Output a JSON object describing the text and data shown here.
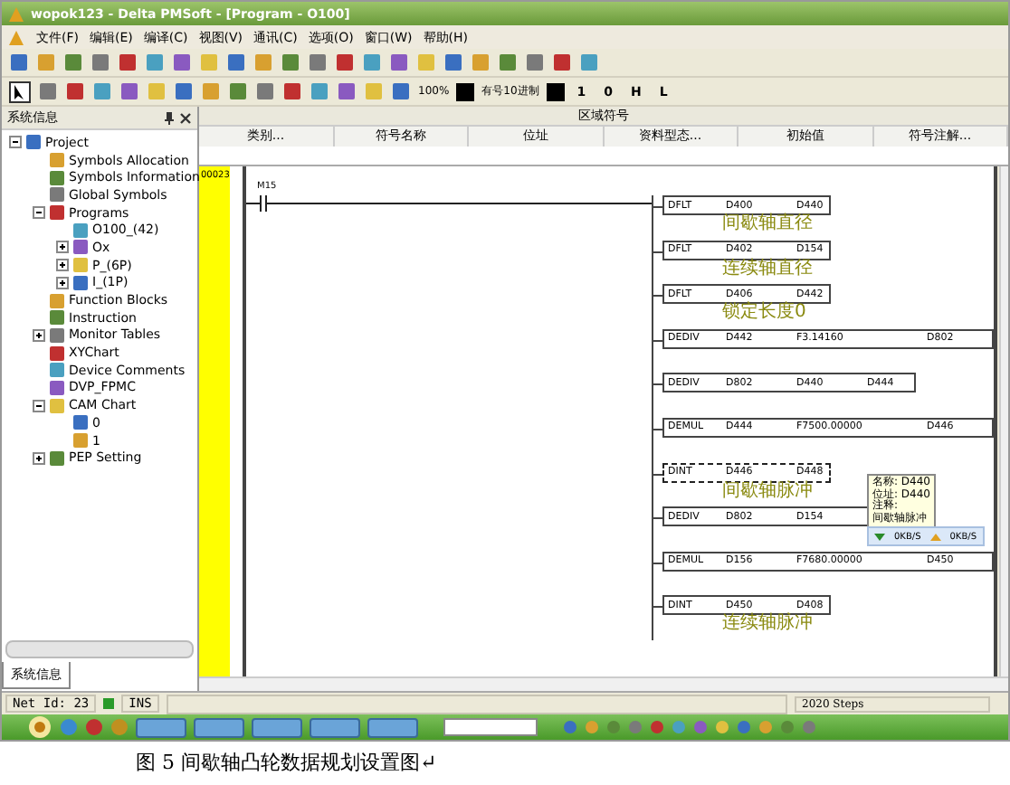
{
  "window": {
    "title": "wopok123 - Delta PMSoft - [Program - O100]"
  },
  "menu": [
    "文件(F)",
    "编辑(E)",
    "编译(C)",
    "视图(V)",
    "通讯(C)",
    "选项(O)",
    "窗口(W)",
    "帮助(H)"
  ],
  "toolbar": {
    "zoom": "100%",
    "number_format": "有号10进制",
    "labels": [
      "1",
      "0",
      "H",
      "L"
    ]
  },
  "system_panel": {
    "title": "系统信息",
    "tab": "系统信息",
    "tree": [
      {
        "label": "Project",
        "expanded": true,
        "children": [
          {
            "label": "Symbols Allocation"
          },
          {
            "label": "Symbols Information"
          },
          {
            "label": "Global Symbols"
          },
          {
            "label": "Programs",
            "expanded": true,
            "children": [
              {
                "label": "O100_(42)"
              },
              {
                "label": "Ox",
                "expanded": false
              },
              {
                "label": "P_(6P)",
                "expanded": false
              },
              {
                "label": "I_(1P)",
                "expanded": false
              }
            ]
          },
          {
            "label": "Function Blocks"
          },
          {
            "label": "Instruction"
          },
          {
            "label": "Monitor Tables",
            "expanded": false
          },
          {
            "label": "XYChart"
          },
          {
            "label": "Device Comments"
          },
          {
            "label": "DVP_FPMC"
          },
          {
            "label": "CAM Chart",
            "expanded": true,
            "children": [
              {
                "label": "0"
              },
              {
                "label": "1"
              }
            ]
          },
          {
            "label": "PEP Setting",
            "expanded": false
          }
        ]
      }
    ]
  },
  "symbol_table": {
    "title": "区域符号",
    "columns": [
      "类别...",
      "符号名称",
      "位址",
      "资料型态...",
      "初始值",
      "符号注解..."
    ]
  },
  "ladder": {
    "line_number": "00023",
    "contact": "M15",
    "rows": [
      {
        "kind": "short",
        "instruction": "DFLT",
        "operands": [
          "D400",
          "D440"
        ],
        "comment": "间歇轴直径",
        "selected": false
      },
      {
        "kind": "short",
        "instruction": "DFLT",
        "operands": [
          "D402",
          "D154"
        ],
        "comment": "连续轴直径",
        "selected": false
      },
      {
        "kind": "short",
        "instruction": "DFLT",
        "operands": [
          "D406",
          "D442"
        ],
        "comment": "锁定长度0",
        "selected": false
      },
      {
        "kind": "long",
        "instruction": "DEDIV",
        "operands": [
          "D442",
          "F3.14160",
          "D802"
        ],
        "selected": false
      },
      {
        "kind": "medium",
        "instruction": "DEDIV",
        "operands": [
          "D802",
          "D440",
          "D444"
        ],
        "selected": false
      },
      {
        "kind": "long",
        "instruction": "DEMUL",
        "operands": [
          "D444",
          "F7500.00000",
          "D446"
        ],
        "selected": false
      },
      {
        "kind": "short",
        "instruction": "DINT",
        "operands": [
          "D446",
          "D448"
        ],
        "comment": "间歇轴脉冲",
        "selected": true
      },
      {
        "kind": "medium",
        "instruction": "DEDIV",
        "operands": [
          "D802",
          "D154"
        ],
        "selected": false
      },
      {
        "kind": "long",
        "instruction": "DEMUL",
        "operands": [
          "D156",
          "F7680.00000",
          "D450"
        ],
        "selected": false
      },
      {
        "kind": "short",
        "instruction": "DINT",
        "operands": [
          "D450",
          "D408"
        ],
        "comment": "连续轴脉冲",
        "selected": false
      }
    ]
  },
  "tooltip": {
    "lines": [
      "名称: D440",
      "位址: D440",
      "注释:",
      "间歇轴脉冲"
    ]
  },
  "net_speed": {
    "upload": "0KB/S",
    "download": "0KB/S"
  },
  "status_bar": {
    "net_id": "Net Id: 23",
    "mode": "INS",
    "steps": "2020 Steps"
  },
  "caption": "图 5 间歇轴凸轮数据规划设置图↵"
}
